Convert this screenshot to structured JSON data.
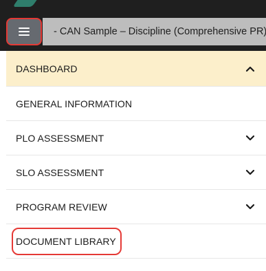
{
  "header": {
    "title": "- CAN Sample – Discipline (Comprehensive PR)",
    "menu_icon": "hamburger-menu-icon",
    "accent": "#e53935"
  },
  "nav": {
    "items": [
      {
        "label": "DASHBOARD",
        "icon": "chevron-up-icon",
        "active": true
      },
      {
        "label": "GENERAL INFORMATION"
      },
      {
        "label": "PLO ASSESSMENT",
        "icon": "chevron-down-icon"
      },
      {
        "label": "SLO ASSESSMENT",
        "icon": "chevron-down-icon"
      },
      {
        "label": "PROGRAM REVIEW",
        "icon": "chevron-down-icon"
      },
      {
        "label": "DOCUMENT LIBRARY"
      }
    ],
    "active_bg": "#fcefcb"
  }
}
